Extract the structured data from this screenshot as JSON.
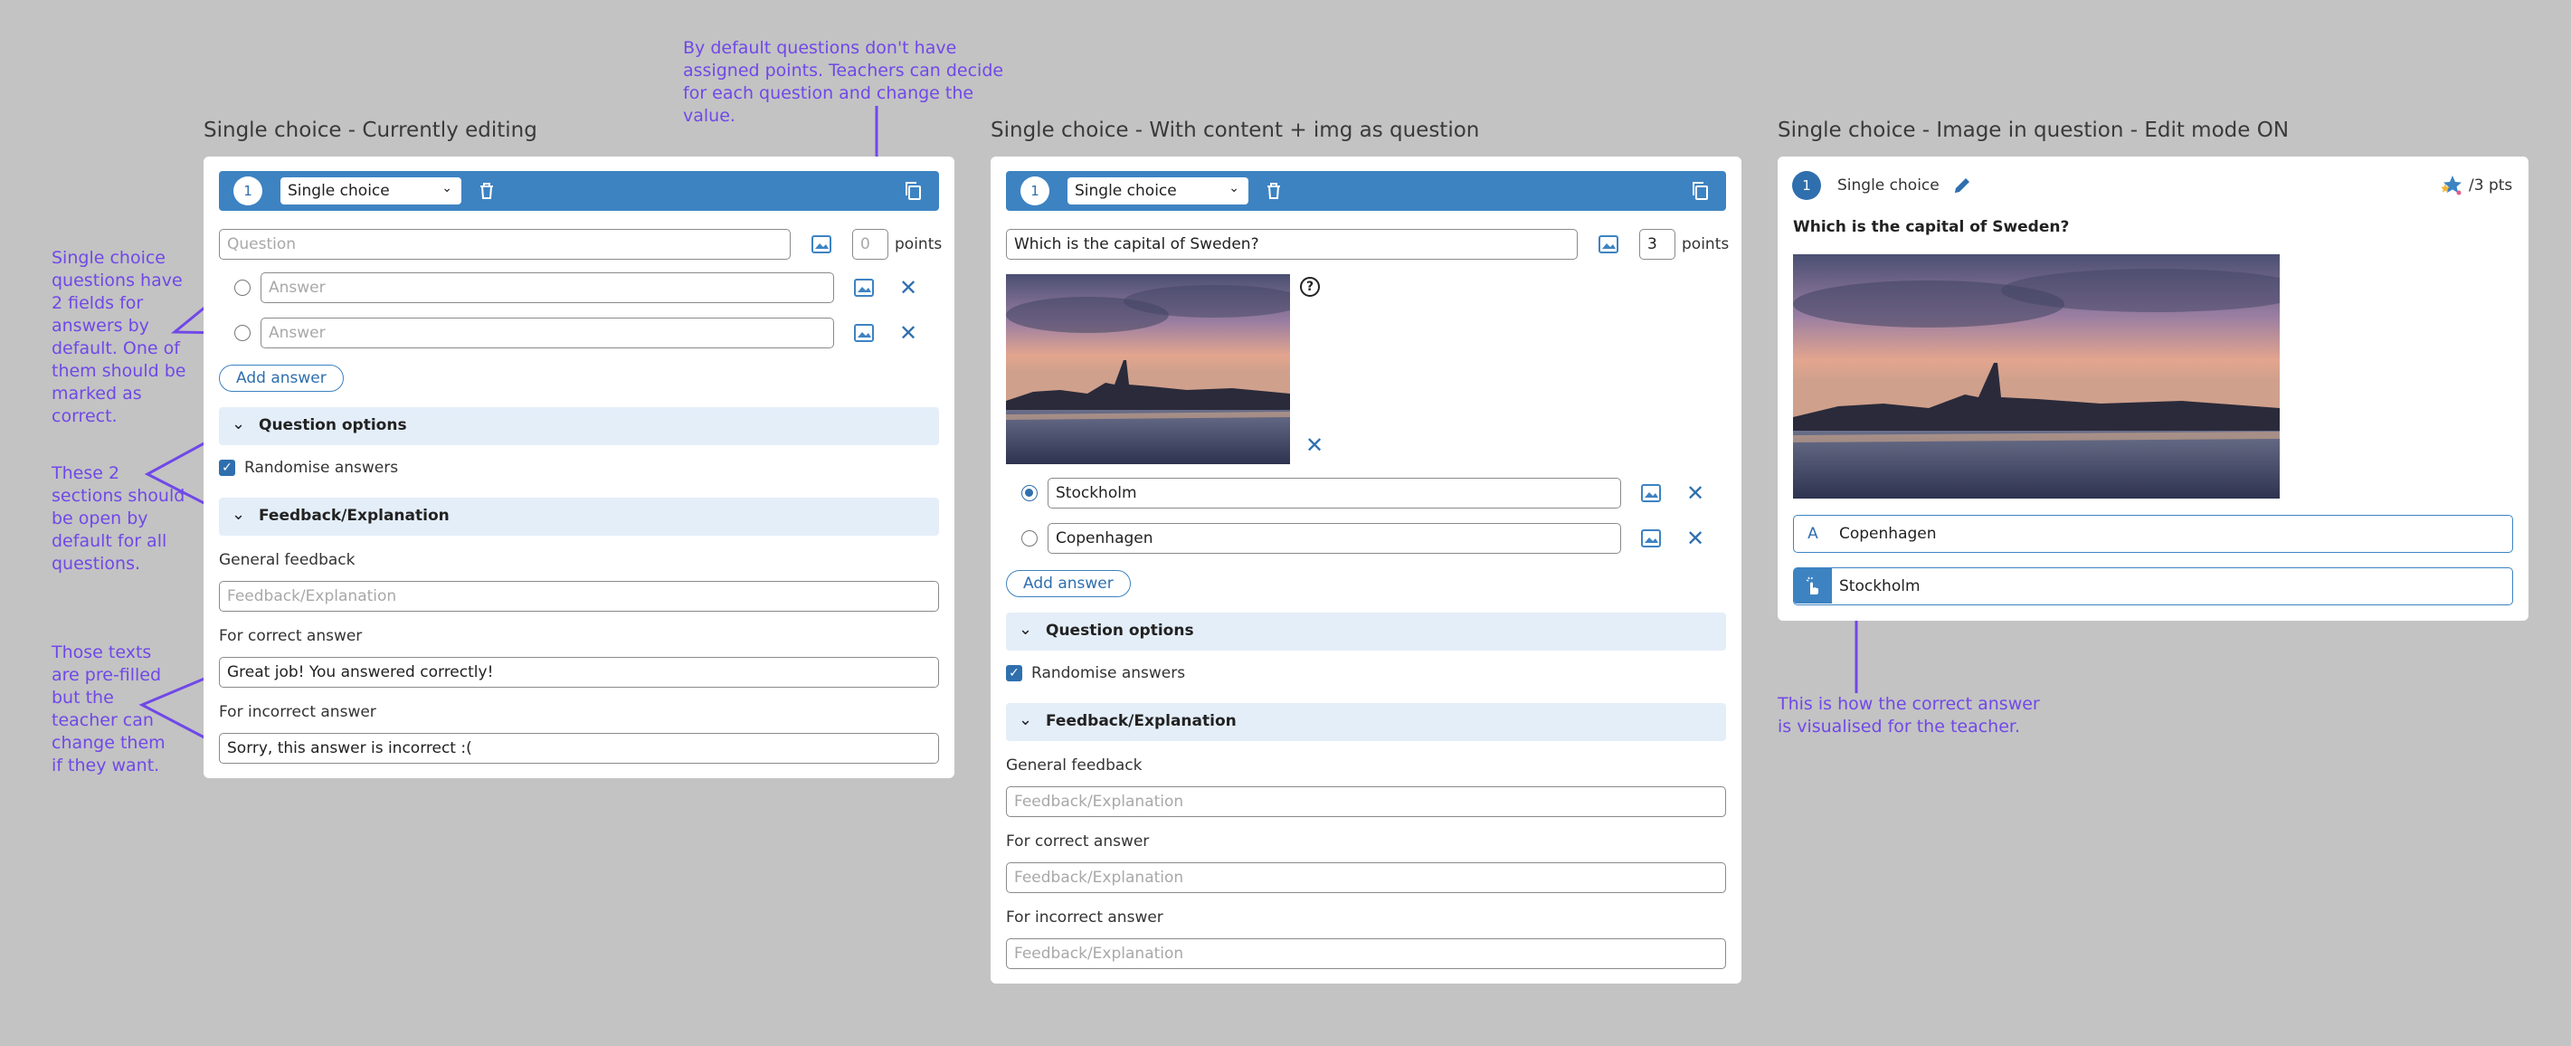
{
  "notes": {
    "points_default": "By default questions don't have assigned points.  Teachers can decide for each question and change the value.",
    "answers_fields": "Single choice questions have 2 fields for answers by default. One of them should be marked as correct.",
    "sections_open": "These 2 sections should be open by default for all questions.",
    "prefilled_texts": "Those texts are pre-filled but the teacher can change them if they want.",
    "correct_visual": "This is how the correct answer is visualised for the teacher."
  },
  "panel1": {
    "title": "Single choice - Currently editing",
    "number": "1",
    "type": "Single choice",
    "question_placeholder": "Question",
    "points_placeholder": "0",
    "points_label": "points",
    "answer_placeholder_1": "Answer",
    "answer_placeholder_2": "Answer",
    "add_answer": "Add answer",
    "question_options": "Question options",
    "randomise": "Randomise answers",
    "feedback_section": "Feedback/Explanation",
    "general_feedback": "General feedback",
    "general_placeholder": "Feedback/Explanation",
    "correct_label": "For correct answer",
    "correct_value": "Great job! You answered correctly!",
    "incorrect_label": "For incorrect answer",
    "incorrect_value": "Sorry, this answer is incorrect :("
  },
  "panel2": {
    "title": "Single choice - With content + img as question",
    "number": "1",
    "type": "Single choice",
    "question_value": "Which is the capital of Sweden?",
    "points_value": "3",
    "points_label": "points",
    "answer_1": "Stockholm",
    "answer_2": "Copenhagen",
    "add_answer": "Add answer",
    "question_options": "Question options",
    "randomise": "Randomise answers",
    "feedback_section": "Feedback/Explanation",
    "general_feedback": "General feedback",
    "general_placeholder": "Feedback/Explanation",
    "correct_label": "For correct answer",
    "correct_placeholder": "Feedback/Explanation",
    "incorrect_label": "For incorrect answer",
    "incorrect_placeholder": "Feedback/Explanation"
  },
  "panel3": {
    "title": "Single choice - Image in question - Edit mode ON",
    "number": "1",
    "type": "Single choice",
    "points": "/3 pts",
    "question": "Which is the capital of Sweden?",
    "answer_a_letter": "A",
    "answer_a": "Copenhagen",
    "answer_b": "Stockholm"
  },
  "colors": {
    "accent": "#3d83c2",
    "annotation": "#7048e8",
    "background": "#c3c3c3"
  }
}
